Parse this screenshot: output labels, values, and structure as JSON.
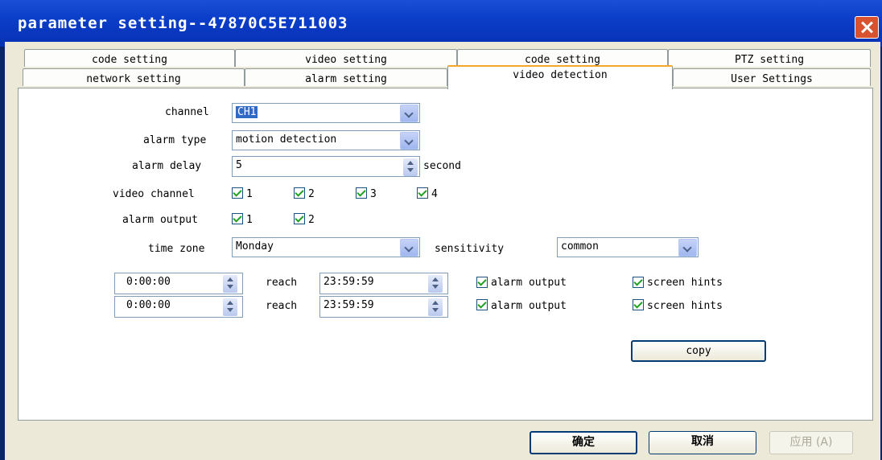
{
  "window": {
    "title": "parameter setting--47870C5E711003"
  },
  "tabs_row1": [
    "code setting",
    "video setting",
    "code setting",
    "PTZ setting"
  ],
  "tabs_row2": [
    "network setting",
    "alarm setting",
    "video detection",
    "User Settings"
  ],
  "form": {
    "channel_label": "channel",
    "channel_value": "CH1",
    "alarm_type_label": "alarm type",
    "alarm_type_value": "motion detection",
    "alarm_delay_label": "alarm delay",
    "alarm_delay_value": "5",
    "alarm_delay_unit": "second",
    "video_channel_label": "video channel",
    "video_channels": [
      "1",
      "2",
      "3",
      "4"
    ],
    "alarm_output_label": "alarm output",
    "alarm_outputs": [
      "1",
      "2"
    ],
    "time_zone_label": "time zone",
    "time_zone_value": "Monday",
    "sensitivity_label": "sensitivity",
    "sensitivity_value": "common"
  },
  "schedule": [
    {
      "start": "0:00:00",
      "reach_label": "reach",
      "end": "23:59:59",
      "alarm_output": "alarm output",
      "screen_hints": "screen hints"
    },
    {
      "start": "0:00:00",
      "reach_label": "reach",
      "end": "23:59:59",
      "alarm_output": "alarm output",
      "screen_hints": "screen hints"
    }
  ],
  "copy_label": "copy",
  "footer": {
    "ok": "确定",
    "cancel": "取消",
    "apply": "应用 (A)"
  },
  "colors": {
    "title_bar": "#0a3ec9",
    "client": "#ece9d8",
    "active_tab": "#f4a72a",
    "check": "#21a121"
  }
}
